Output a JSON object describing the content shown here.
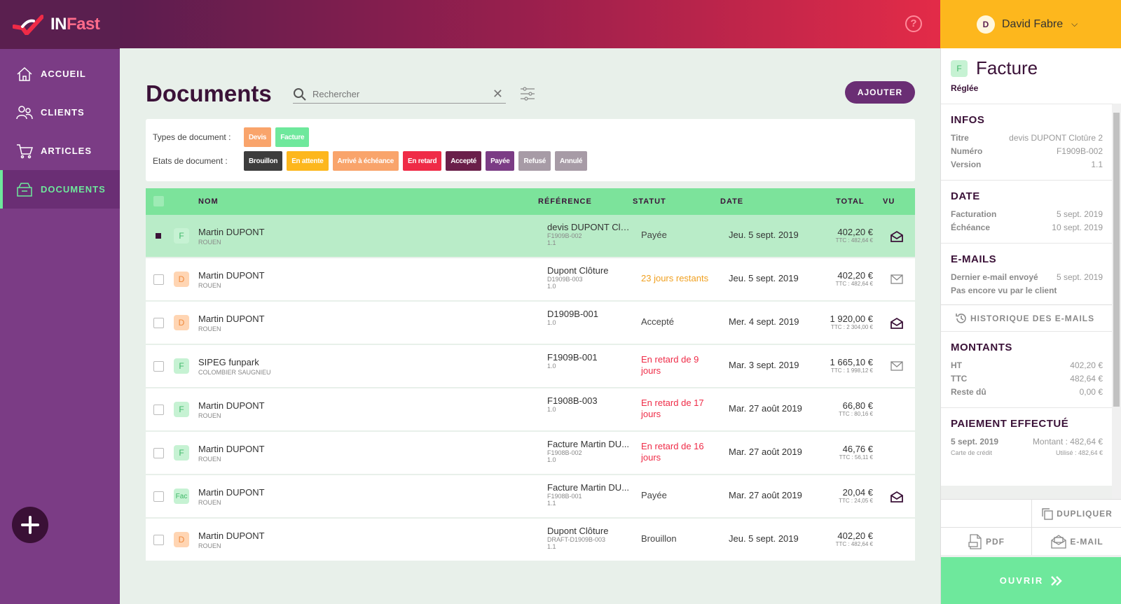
{
  "app": {
    "logo_in": "IN",
    "logo_fast": "Fast"
  },
  "sidebar": {
    "items": [
      {
        "label": "ACCUEIL",
        "icon": "home-icon"
      },
      {
        "label": "CLIENTS",
        "icon": "users-icon"
      },
      {
        "label": "ARTICLES",
        "icon": "cart-icon"
      },
      {
        "label": "DOCUMENTS",
        "icon": "box-icon",
        "active": true
      }
    ],
    "fab_icon": "plus-icon"
  },
  "topbar": {
    "help_icon": "?"
  },
  "user": {
    "initial": "D",
    "name": "David Fabre"
  },
  "main": {
    "title": "Documents",
    "search": {
      "placeholder": "Rechercher"
    },
    "add_label": "AJOUTER",
    "filters": {
      "types_label": "Types de document :",
      "types": [
        {
          "label": "Devis",
          "color": "#f9a46b"
        },
        {
          "label": "Facture",
          "color": "#6ee89c"
        }
      ],
      "states_label": "Etats de document :",
      "states": [
        {
          "label": "Brouillon",
          "color": "#3d3d3d"
        },
        {
          "label": "En attente",
          "color": "#fdb71d"
        },
        {
          "label": "Arrivé à échéance",
          "color": "#f9a46b"
        },
        {
          "label": "En retard",
          "color": "#ef2b47"
        },
        {
          "label": "Accepté",
          "color": "#6a1f4a"
        },
        {
          "label": "Payée",
          "color": "#7b3c85"
        },
        {
          "label": "Refusé",
          "color": "#a79ba6"
        },
        {
          "label": "Annulé",
          "color": "#a79ba6"
        }
      ]
    },
    "table": {
      "headers": {
        "name": "NOM",
        "ref": "RÉFÉRENCE",
        "status": "STATUT",
        "date": "DATE",
        "total": "TOTAL",
        "seen": "VU"
      },
      "rows": [
        {
          "type": "F",
          "name": "Martin DUPONT",
          "city": "ROUEN",
          "ref_title": "devis DUPONT Clot...",
          "ref_num": "F1909B-002",
          "version": "1.1",
          "status": "Payée",
          "status_color": "#444",
          "date": "Jeu. 5 sept. 2019",
          "total": "402,20 €",
          "ttc": "TTC : 482,64 €",
          "mail": "opened"
        },
        {
          "type": "D",
          "name": "Martin DUPONT",
          "city": "ROUEN",
          "ref_title": "Dupont Clôture",
          "ref_num": "D1909B-003",
          "version": "1.0",
          "status": "23 jours restants",
          "status_color": "#f0a020",
          "date": "Jeu. 5 sept. 2019",
          "total": "402,20 €",
          "ttc": "TTC : 482,64 €",
          "mail": "closed"
        },
        {
          "type": "D",
          "name": "Martin DUPONT",
          "city": "ROUEN",
          "ref_title": "D1909B-001",
          "ref_num": "",
          "version": "1.0",
          "status": "Accepté",
          "status_color": "#444",
          "date": "Mer. 4 sept. 2019",
          "total": "1 920,00 €",
          "ttc": "TTC : 2 304,00 €",
          "mail": "opened"
        },
        {
          "type": "F",
          "name": "SIPEG funpark",
          "city": "COLOMBIER SAUGNIEU",
          "ref_title": "F1909B-001",
          "ref_num": "",
          "version": "1.0",
          "status": "En retard de 9 jours",
          "status_color": "#ef2b47",
          "date": "Mar. 3 sept. 2019",
          "total": "1 665,10 €",
          "ttc": "TTC : 1 998,12 €",
          "mail": "closed"
        },
        {
          "type": "F",
          "name": "Martin DUPONT",
          "city": "ROUEN",
          "ref_title": "F1908B-003",
          "ref_num": "",
          "version": "1.0",
          "status": "En retard de 17 jours",
          "status_color": "#ef2b47",
          "date": "Mar. 27 août 2019",
          "total": "66,80 €",
          "ttc": "TTC : 80,16 €",
          "mail": ""
        },
        {
          "type": "F",
          "name": "Martin DUPONT",
          "city": "ROUEN",
          "ref_title": "Facture Martin DU...",
          "ref_num": "F1908B-002",
          "version": "1.0",
          "status": "En retard de 16 jours",
          "status_color": "#ef2b47",
          "date": "Mar. 27 août 2019",
          "total": "46,76 €",
          "ttc": "TTC : 56,11 €",
          "mail": ""
        },
        {
          "type": "Fac",
          "name": "Martin DUPONT",
          "city": "ROUEN",
          "ref_title": "Facture Martin DU...",
          "ref_num": "F1908B-001",
          "version": "1.1",
          "status": "Payée",
          "status_color": "#444",
          "date": "Mar. 27 août 2019",
          "total": "20,04 €",
          "ttc": "TTC : 24,05 €",
          "mail": "opened"
        },
        {
          "type": "D",
          "name": "Martin DUPONT",
          "city": "ROUEN",
          "ref_title": "Dupont Clôture",
          "ref_num": "DRAFT-D1909B-003",
          "version": "1.1",
          "status": "Brouillon",
          "status_color": "#444",
          "date": "Jeu. 5 sept. 2019",
          "total": "402,20 €",
          "ttc": "TTC : 482,64 €",
          "mail": ""
        }
      ]
    }
  },
  "panel": {
    "type_badge": "F",
    "title": "Facture",
    "state": "Réglée",
    "infos": {
      "heading": "INFOS",
      "rows": [
        {
          "k": "Titre",
          "v": "devis DUPONT Clotûre 2"
        },
        {
          "k": "Numéro",
          "v": "F1909B-002"
        },
        {
          "k": "Version",
          "v": "1.1"
        }
      ]
    },
    "date": {
      "heading": "DATE",
      "rows": [
        {
          "k": "Facturation",
          "v": "5 sept. 2019"
        },
        {
          "k": "Échéance",
          "v": "10 sept. 2019"
        }
      ]
    },
    "emails": {
      "heading": "E-MAILS",
      "last_label": "Dernier e-mail envoyé",
      "last_date": "5 sept. 2019",
      "not_seen": "Pas encore vu par le client",
      "history": "HISTORIQUE DES E-MAILS"
    },
    "amounts": {
      "heading": "MONTANTS",
      "rows": [
        {
          "k": "HT",
          "v": "402,20 €"
        },
        {
          "k": "TTC",
          "v": "482,64 €"
        },
        {
          "k": "Reste dû",
          "v": "0,00 €"
        }
      ]
    },
    "payment": {
      "heading": "PAIEMENT EFFECTUÉ",
      "date": "5 sept. 2019",
      "amount": "Montant : 482,64 €",
      "method": "Carte de crédit",
      "used": "Utilisé : 482,64 €"
    },
    "actions": {
      "duplicate": "DUPLIQUER",
      "pdf": "PDF",
      "email": "E-MAIL",
      "open": "OUVRIR"
    }
  }
}
